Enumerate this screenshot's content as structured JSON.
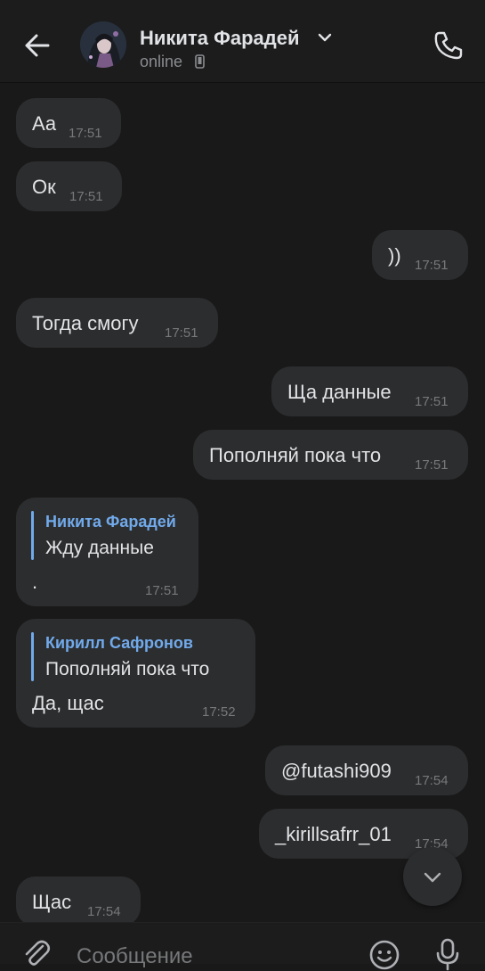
{
  "header": {
    "name": "Никита Фарадей",
    "status": "online"
  },
  "messages": [
    {
      "text": "Аа",
      "time": "17:51"
    },
    {
      "text": "Ок",
      "time": "17:51"
    },
    {
      "text": "))",
      "time": "17:51"
    },
    {
      "text": "Тогда смогу",
      "time": "17:51"
    },
    {
      "text": "Ща данные",
      "time": "17:51"
    },
    {
      "text": "Пополняй пока что",
      "time": "17:51"
    },
    {
      "reply_name": "Никита Фарадей",
      "reply_text": "Жду данные",
      "text": ".",
      "time": "17:51"
    },
    {
      "reply_name": "Кирилл Сафронов",
      "reply_text": "Пополняй пока что",
      "text": "Да, щас",
      "time": "17:52"
    },
    {
      "text": "@futashi909",
      "time": "17:54"
    },
    {
      "text": "_kirillsafrr_01",
      "time": "17:54"
    },
    {
      "text": "Щас",
      "time": "17:54"
    }
  ],
  "composer": {
    "placeholder": "Сообщение"
  },
  "icons": {
    "back": "arrow-left-icon",
    "chevron": "chevron-down-icon",
    "device": "mobile-phone-icon",
    "call": "phone-call-icon",
    "scroll": "chevron-down-icon",
    "attach": "paperclip-icon",
    "emoji": "smile-icon",
    "mic": "microphone-icon"
  }
}
